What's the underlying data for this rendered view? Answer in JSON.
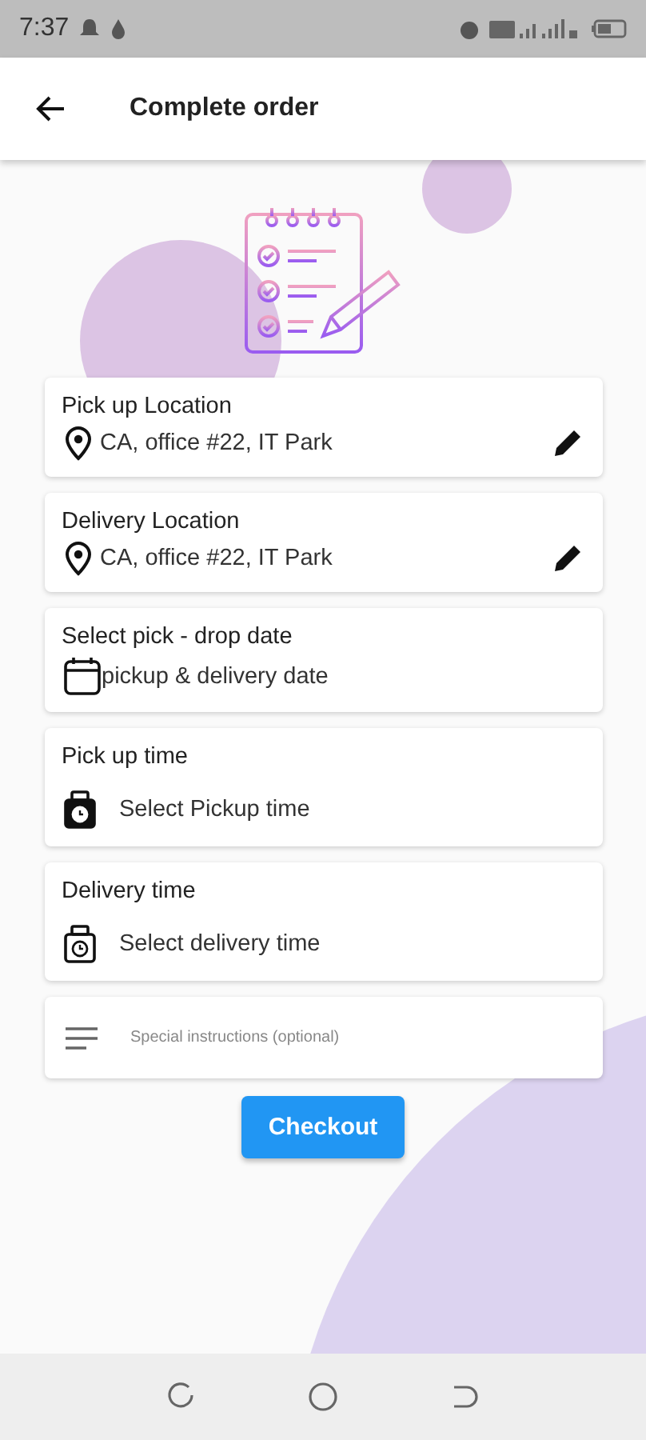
{
  "status_bar": {
    "time": "7:37"
  },
  "app_bar": {
    "title": "Complete order"
  },
  "fields": [
    {
      "kind": "location",
      "label": "Pick up Location",
      "value": "CA, office #22, IT Park"
    },
    {
      "kind": "location",
      "label": "Delivery Location",
      "value": "CA, office #22, IT Park"
    },
    {
      "kind": "date",
      "label": "Select pick - drop date",
      "value": "pickup & delivery date"
    },
    {
      "kind": "time",
      "label": "Pick up time",
      "value": "Select Pickup time"
    },
    {
      "kind": "time",
      "label": "Delivery time",
      "value": "Select delivery time"
    },
    {
      "kind": "notes",
      "placeholder": "Special instructions (optional)"
    }
  ],
  "checkout_button": {
    "label": "Checkout"
  }
}
